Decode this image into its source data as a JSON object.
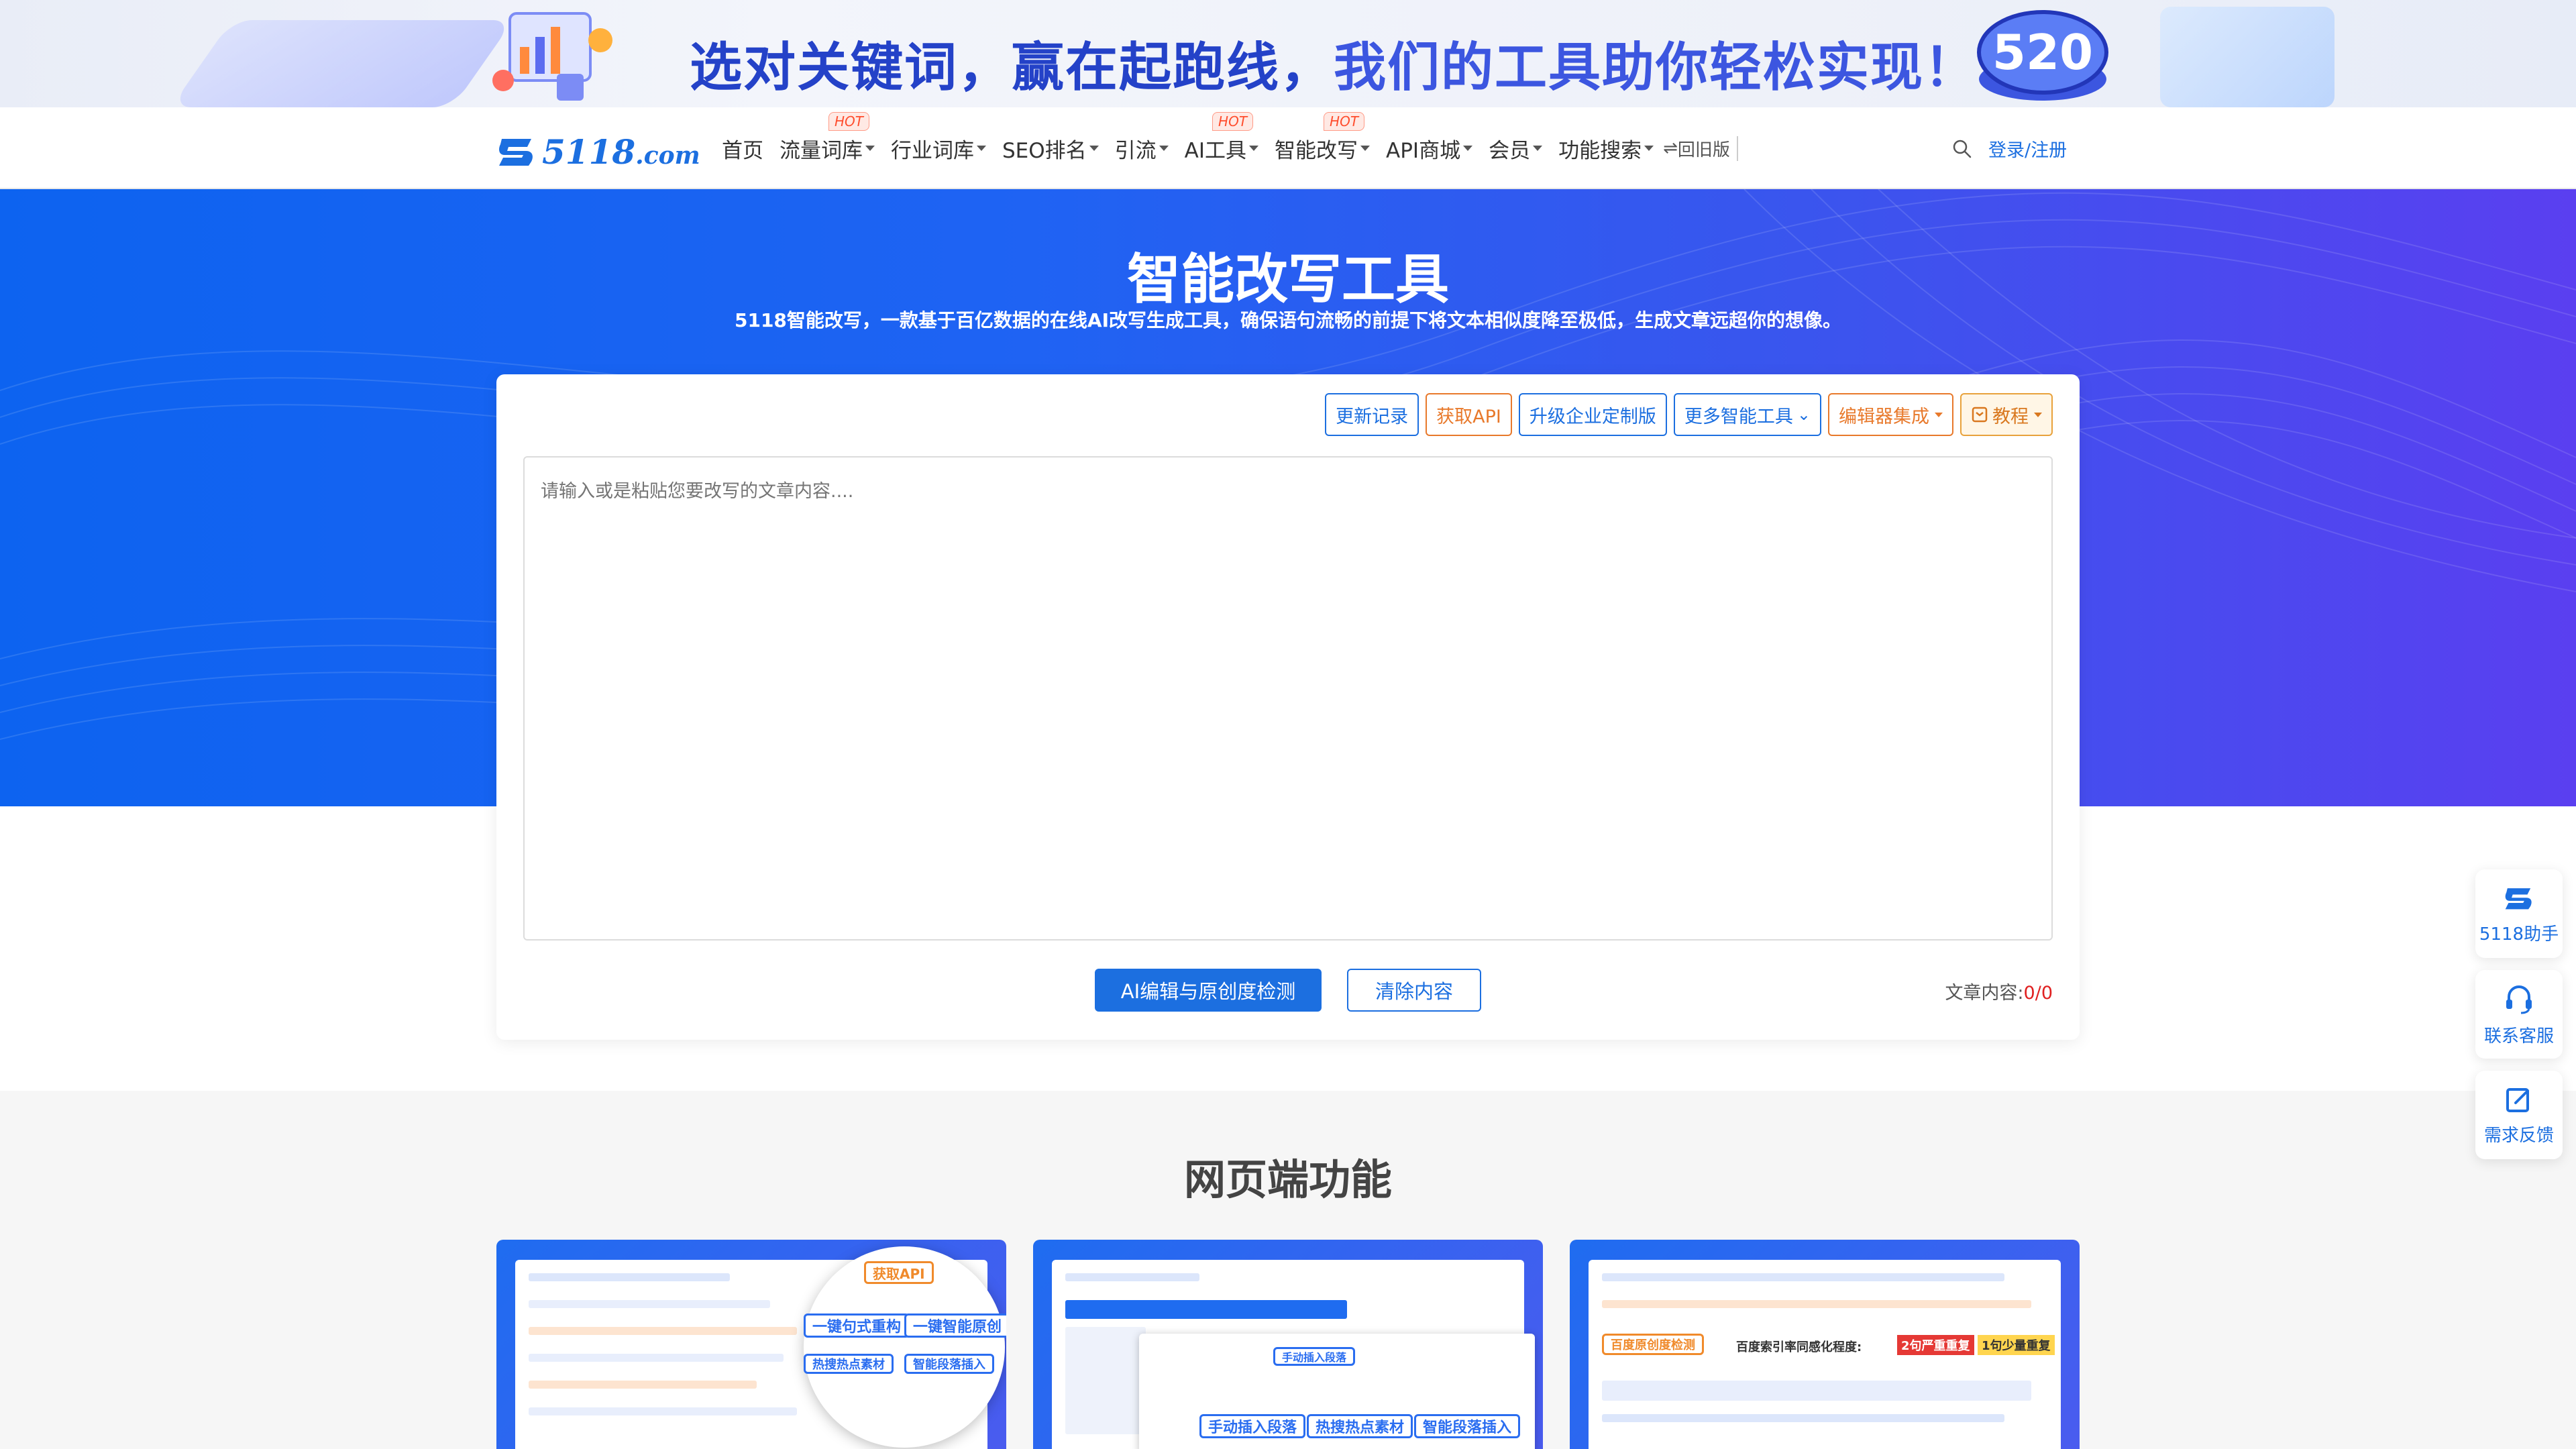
{
  "banner": {
    "text_main": "选对关键词，赢在起跑线，",
    "text_accent": "我们的工具助你轻松实现！",
    "badge": "520"
  },
  "nav": {
    "logo_text": "5118",
    "logo_suffix": ".com",
    "items": [
      {
        "label": "首页",
        "dropdown": false,
        "hot": false
      },
      {
        "label": "流量词库",
        "dropdown": true,
        "hot": true
      },
      {
        "label": "行业词库",
        "dropdown": true,
        "hot": false
      },
      {
        "label": "SEO排名",
        "dropdown": true,
        "hot": false
      },
      {
        "label": "引流",
        "dropdown": true,
        "hot": false
      },
      {
        "label": "AI工具",
        "dropdown": true,
        "hot": true
      },
      {
        "label": "智能改写",
        "dropdown": true,
        "hot": true
      },
      {
        "label": "API商城",
        "dropdown": true,
        "hot": false
      },
      {
        "label": "会员",
        "dropdown": true,
        "hot": false
      },
      {
        "label": "功能搜索",
        "dropdown": true,
        "hot": false
      }
    ],
    "hot_label": "HOT",
    "old_version": "回旧版",
    "login": "登录/注册"
  },
  "hero": {
    "title": "智能改写工具",
    "subtitle": "5118智能改写，一款基于百亿数据的在线AI改写生成工具，确保语句流畅的前提下将文本相似度降至极低，生成文章远超你的想像。"
  },
  "toolbar": {
    "update_log": "更新记录",
    "get_api": "获取API",
    "enterprise": "升级企业定制版",
    "more_tools": "更多智能工具",
    "editor_integration": "编辑器集成",
    "tutorial": "教程"
  },
  "editor": {
    "placeholder": "请输入或是粘贴您要改写的文章内容....",
    "value": ""
  },
  "actions": {
    "check": "AI编辑与原创度检测",
    "clear": "清除内容",
    "count_label": "文章内容:",
    "count_value": "0/0"
  },
  "features": {
    "title": "网页端功能",
    "card1_chips": [
      "获取API",
      "一键句式重构",
      "一键智能原创",
      "热搜热点素材",
      "智能段落插入"
    ],
    "card2_chips": [
      "手动插入段落",
      "热搜热点素材",
      "智能段落插入"
    ],
    "card3_chips": [
      "百度原创度检测",
      "百度索引率同感化程度:",
      "2句严重重复",
      "1句少量重复"
    ]
  },
  "floats": [
    {
      "label": "5118助手",
      "icon": "assistant-logo-icon"
    },
    {
      "label": "联系客服",
      "icon": "headset-icon"
    },
    {
      "label": "需求反馈",
      "icon": "feedback-edit-icon"
    }
  ],
  "colors": {
    "primary": "#1c6fe0",
    "hero_start": "#0d63f0",
    "hero_end": "#5a3ff0",
    "orange": "#e8792b",
    "hot": "#ff4d2d"
  }
}
